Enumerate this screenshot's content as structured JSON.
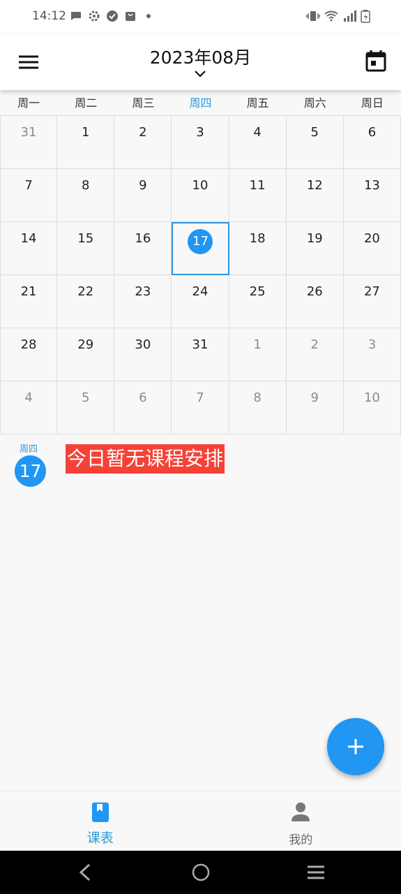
{
  "status_bar": {
    "time": "14:12"
  },
  "header": {
    "title": "2023年08月"
  },
  "weekdays": [
    "周一",
    "周二",
    "周三",
    "周四",
    "周五",
    "周六",
    "周日"
  ],
  "today_weekday_index": 3,
  "calendar": {
    "days": [
      {
        "n": "31",
        "muted": true
      },
      {
        "n": "1"
      },
      {
        "n": "2"
      },
      {
        "n": "3"
      },
      {
        "n": "4"
      },
      {
        "n": "5"
      },
      {
        "n": "6"
      },
      {
        "n": "7"
      },
      {
        "n": "8"
      },
      {
        "n": "9"
      },
      {
        "n": "10"
      },
      {
        "n": "11"
      },
      {
        "n": "12"
      },
      {
        "n": "13"
      },
      {
        "n": "14"
      },
      {
        "n": "15"
      },
      {
        "n": "16"
      },
      {
        "n": "17",
        "selected": true
      },
      {
        "n": "18"
      },
      {
        "n": "19"
      },
      {
        "n": "20"
      },
      {
        "n": "21"
      },
      {
        "n": "22"
      },
      {
        "n": "23"
      },
      {
        "n": "24"
      },
      {
        "n": "25"
      },
      {
        "n": "26"
      },
      {
        "n": "27"
      },
      {
        "n": "28"
      },
      {
        "n": "29"
      },
      {
        "n": "30"
      },
      {
        "n": "31"
      },
      {
        "n": "1",
        "muted": true
      },
      {
        "n": "2",
        "muted": true
      },
      {
        "n": "3",
        "muted": true
      },
      {
        "n": "4",
        "muted": true
      },
      {
        "n": "5",
        "muted": true
      },
      {
        "n": "6",
        "muted": true
      },
      {
        "n": "7",
        "muted": true
      },
      {
        "n": "8",
        "muted": true
      },
      {
        "n": "9",
        "muted": true
      },
      {
        "n": "10",
        "muted": true
      }
    ]
  },
  "selected_day": {
    "weekday": "周四",
    "day": "17",
    "message": "今日暂无课程安排"
  },
  "bottom_nav": {
    "items": [
      {
        "label": "课表",
        "active": true
      },
      {
        "label": "我的",
        "active": false
      }
    ]
  },
  "colors": {
    "accent": "#2196f3",
    "accent_text": "#2a9bd8",
    "highlight": "#f44336"
  }
}
